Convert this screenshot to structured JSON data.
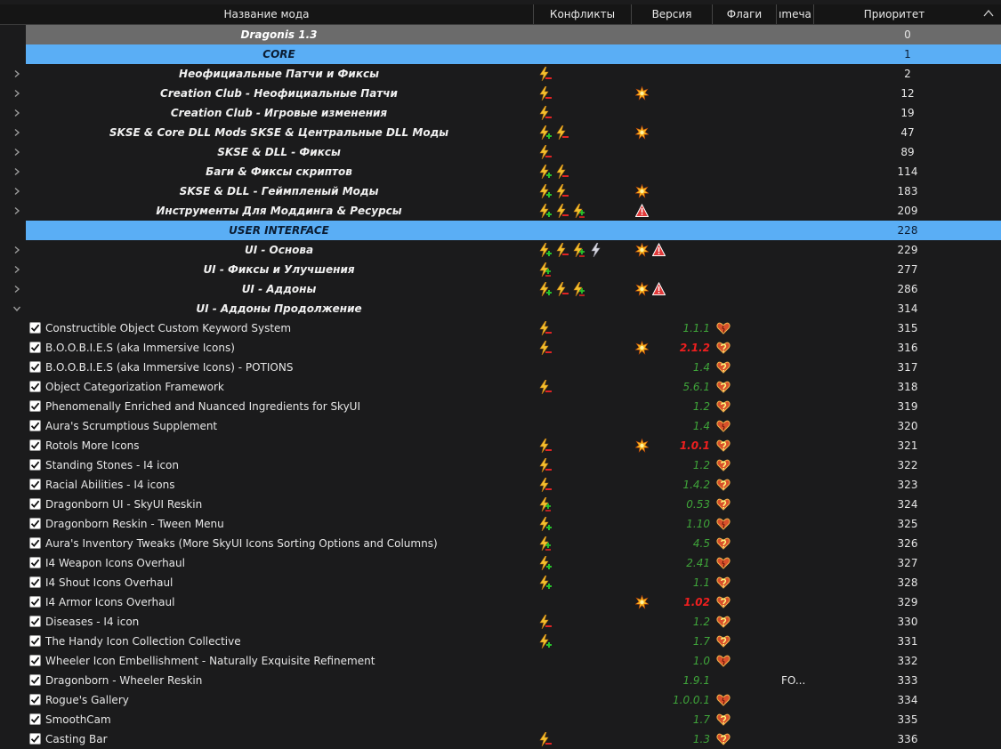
{
  "header": {
    "col_name": "Название мода",
    "col_conflicts": "Конфликты",
    "col_version": "Версия",
    "col_flags": "Флаги",
    "col_category": "ımeча",
    "col_priority": "Приоритет"
  },
  "colors": {
    "separator_gray": "#6b6b6b",
    "separator_blue": "#5aaef5",
    "version_ok": "#3fa53a",
    "version_bad": "#ee1f1f",
    "highlight_mark": "#e01818"
  },
  "rows": [
    {
      "type": "sep-gray",
      "title": "Dragonis 1.3",
      "priority": "0"
    },
    {
      "type": "sep-blue",
      "title": "CORE",
      "priority": "1"
    },
    {
      "type": "group",
      "title": "Неофициальные Патчи и Фиксы",
      "priority": "2",
      "conflicts": [
        "conflict-overwritten-icon"
      ],
      "flags": []
    },
    {
      "type": "group",
      "title": "Creation Club - Неофициальные Патчи",
      "priority": "12",
      "conflicts": [
        "conflict-overwritten-icon"
      ],
      "flags": [
        "star-flag-icon"
      ]
    },
    {
      "type": "group",
      "title": "Creation Club - Игровые изменения",
      "priority": "19",
      "conflicts": [
        "conflict-overwritten-icon"
      ],
      "flags": []
    },
    {
      "type": "group",
      "title": "SKSE & Core DLL Mods SKSE & Центральные DLL Моды",
      "priority": "47",
      "conflicts": [
        "conflict-overwrite-icon",
        "conflict-overwritten-icon"
      ],
      "flags": [
        "star-flag-icon"
      ]
    },
    {
      "type": "group",
      "title": "SKSE & DLL - Фиксы",
      "priority": "89",
      "conflicts": [
        "conflict-overwritten-icon"
      ],
      "flags": []
    },
    {
      "type": "group",
      "title": "Баги & Фиксы скриптов",
      "priority": "114",
      "conflicts": [
        "conflict-overwrite-icon",
        "conflict-overwritten-icon"
      ],
      "flags": []
    },
    {
      "type": "group",
      "title": "SKSE & DLL - Геймпленый Моды",
      "priority": "183",
      "conflicts": [
        "conflict-overwrite-icon",
        "conflict-overwritten-icon"
      ],
      "flags": [
        "star-flag-icon"
      ]
    },
    {
      "type": "group",
      "title": "Инструменты Для Моддинга & Ресурсы",
      "priority": "209",
      "conflicts": [
        "conflict-overwrite-icon",
        "conflict-overwritten-icon",
        "conflict-mixed-icon"
      ],
      "flags": [
        "warning-flag-icon"
      ]
    },
    {
      "type": "sep-blue",
      "title": "USER INTERFACE",
      "priority": "228"
    },
    {
      "type": "group",
      "title": "UI - Основа",
      "priority": "229",
      "conflicts": [
        "conflict-overwrite-icon",
        "conflict-overwritten-icon",
        "conflict-mixed-icon",
        "conflict-redundant-icon"
      ],
      "flags": [
        "star-flag-icon",
        "warning-flag-icon"
      ]
    },
    {
      "type": "group",
      "title": "UI - Фиксы и Улучшения",
      "priority": "277",
      "conflicts": [
        "conflict-mixed-icon"
      ],
      "flags": []
    },
    {
      "type": "group",
      "title": "UI - Аддоны",
      "priority": "286",
      "conflicts": [
        "conflict-overwrite-icon",
        "conflict-overwritten-icon",
        "conflict-mixed-icon"
      ],
      "flags": [
        "star-flag-icon",
        "warning-flag-icon"
      ]
    },
    {
      "type": "group-open",
      "title": "UI - Аддоны Продолжение",
      "priority": "314",
      "conflicts": [],
      "flags": []
    },
    {
      "type": "mod",
      "name": "Constructible Object Custom Keyword System",
      "priority": "315",
      "conflicts": [
        "conflict-overwritten-icon"
      ],
      "flags": [],
      "version": "1.1.1",
      "vbad": false,
      "vstat": "heart-icon"
    },
    {
      "type": "mod",
      "name": "B.O.O.B.I.E.S (aka Immersive Icons)",
      "priority": "316",
      "conflicts": [
        "conflict-overwritten-icon"
      ],
      "flags": [
        "star-flag-icon"
      ],
      "version": "2.1.2",
      "vbad": true,
      "vstat": "question-heart-icon"
    },
    {
      "type": "mod",
      "name": "B.O.O.B.I.E.S (aka Immersive Icons) - POTIONS",
      "priority": "317",
      "conflicts": [],
      "flags": [],
      "version": "1.4",
      "vbad": false,
      "vstat": "question-heart-icon"
    },
    {
      "type": "mod",
      "name": "Object Categorization Framework",
      "priority": "318",
      "conflicts": [
        "conflict-overwritten-icon"
      ],
      "flags": [],
      "version": "5.6.1",
      "vbad": false,
      "vstat": "question-heart-icon"
    },
    {
      "type": "mod",
      "name": "Phenomenally Enriched and Nuanced Ingredients for SkyUI",
      "priority": "319",
      "conflicts": [],
      "flags": [],
      "version": "1.2",
      "vbad": false,
      "vstat": "question-heart-icon"
    },
    {
      "type": "mod",
      "name": "Aura's Scrumptious Supplement",
      "priority": "320",
      "conflicts": [],
      "flags": [],
      "version": "1.4",
      "vbad": false,
      "vstat": "heart-icon"
    },
    {
      "type": "mod",
      "name": "Rotols More Icons",
      "priority": "321",
      "conflicts": [
        "conflict-overwritten-icon"
      ],
      "flags": [
        "star-flag-icon"
      ],
      "version": "1.0.1",
      "vbad": true,
      "vstat": "question-heart-icon"
    },
    {
      "type": "mod",
      "name": "Standing Stones - I4 icon",
      "priority": "322",
      "conflicts": [
        "conflict-overwritten-icon"
      ],
      "flags": [],
      "version": "1.2",
      "vbad": false,
      "vstat": "question-heart-icon"
    },
    {
      "type": "mod",
      "name": "Racial Abilities - I4 icons",
      "priority": "323",
      "conflicts": [
        "conflict-overwritten-icon"
      ],
      "flags": [],
      "version": "1.4.2",
      "vbad": false,
      "vstat": "question-heart-icon"
    },
    {
      "type": "mod",
      "name": "Dragonborn UI - SkyUI Reskin",
      "priority": "324",
      "conflicts": [
        "conflict-mixed-icon"
      ],
      "flags": [],
      "version": "0.53",
      "vbad": false,
      "vstat": "question-heart-icon"
    },
    {
      "type": "mod",
      "name": "Dragonborn Reskin - Tween Menu",
      "priority": "325",
      "conflicts": [
        "conflict-overwrite-icon"
      ],
      "flags": [],
      "version": "1.10",
      "vbad": false,
      "vstat": "heart-icon"
    },
    {
      "type": "mod",
      "name": "Aura's Inventory Tweaks (More SkyUI Icons Sorting Options and Columns)",
      "priority": "326",
      "conflicts": [
        "conflict-mixed-icon"
      ],
      "flags": [],
      "version": "4.5",
      "vbad": false,
      "vstat": "question-heart-icon"
    },
    {
      "type": "mod",
      "name": "I4 Weapon Icons Overhaul",
      "priority": "327",
      "conflicts": [
        "conflict-overwrite-icon"
      ],
      "flags": [],
      "version": "2.41",
      "vbad": false,
      "vstat": "heart-icon"
    },
    {
      "type": "mod",
      "name": "I4 Shout Icons Overhaul",
      "priority": "328",
      "conflicts": [
        "conflict-overwrite-icon"
      ],
      "flags": [],
      "version": "1.1",
      "vbad": false,
      "vstat": "question-heart-icon"
    },
    {
      "type": "mod",
      "name": "I4 Armor Icons Overhaul",
      "priority": "329",
      "conflicts": [],
      "flags": [
        "star-flag-icon"
      ],
      "version": "1.02",
      "vbad": true,
      "vstat": "question-heart-icon"
    },
    {
      "type": "mod",
      "name": "Diseases - I4 icon",
      "priority": "330",
      "conflicts": [
        "conflict-overwritten-icon"
      ],
      "flags": [],
      "version": "1.2",
      "vbad": false,
      "vstat": "question-heart-icon"
    },
    {
      "type": "mod",
      "name": "The Handy Icon Collection Collective",
      "priority": "331",
      "conflicts": [
        "conflict-overwrite-icon"
      ],
      "flags": [],
      "version": "1.7",
      "vbad": false,
      "vstat": "question-heart-icon"
    },
    {
      "type": "mod",
      "name": "Wheeler Icon Embellishment - Naturally Exquisite Refinement",
      "priority": "332",
      "conflicts": [],
      "flags": [],
      "version": "1.0",
      "vbad": false,
      "vstat": "heart-icon"
    },
    {
      "type": "mod",
      "name": "Dragonborn - Wheeler Reskin",
      "priority": "333",
      "conflicts": [],
      "flags": [],
      "version": "1.9.1",
      "vbad": false,
      "vstat": "",
      "category": "FO..."
    },
    {
      "type": "mod",
      "name": "Rogue's Gallery",
      "priority": "334",
      "conflicts": [],
      "flags": [],
      "version": "1.0.0.1",
      "vbad": false,
      "vstat": "heart-icon"
    },
    {
      "type": "mod",
      "name": "SmoothCam",
      "priority": "335",
      "conflicts": [],
      "flags": [],
      "version": "1.7",
      "vbad": false,
      "vstat": "question-heart-icon"
    },
    {
      "type": "mod",
      "name": "Casting Bar",
      "priority": "336",
      "conflicts": [
        "conflict-overwritten-icon"
      ],
      "flags": [],
      "version": "1.3",
      "vbad": false,
      "vstat": "question-heart-icon"
    }
  ]
}
